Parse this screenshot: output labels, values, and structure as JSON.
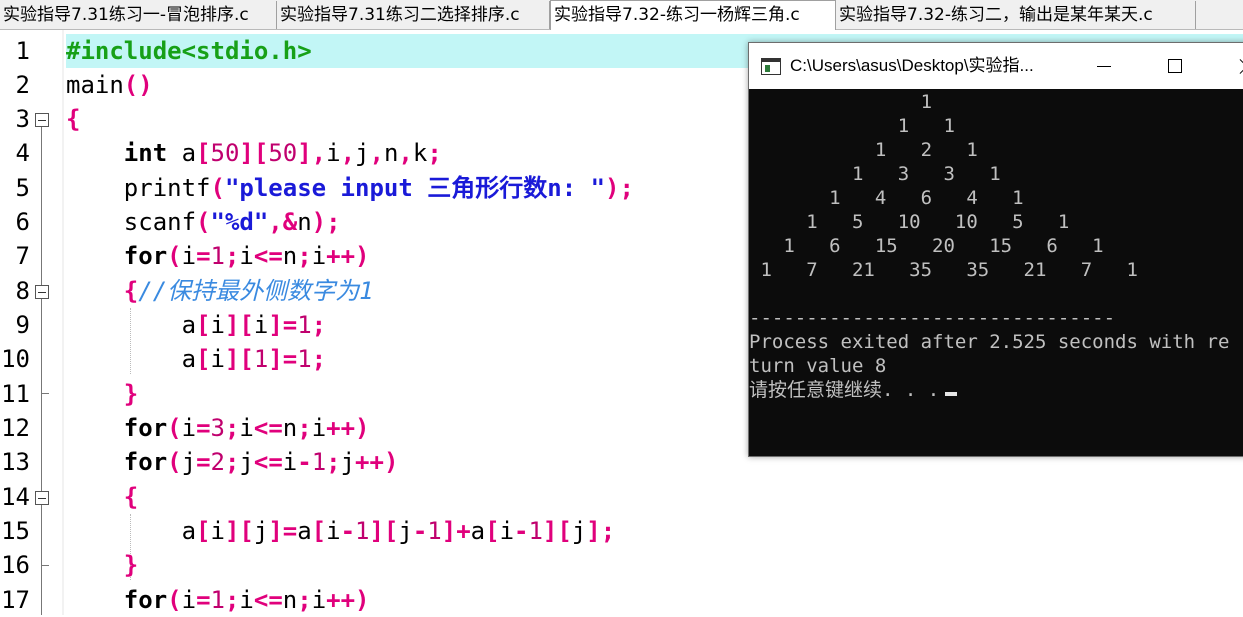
{
  "tabs": [
    {
      "label": "实验指导7.31练习一-冒泡排序.c",
      "active": false
    },
    {
      "label": "实验指导7.31练习二选择排序.c",
      "active": false
    },
    {
      "label": "实验指导7.32-练习一杨辉三角.c",
      "active": true
    },
    {
      "label": "实验指导7.32-练习二，输出是某年某天.c",
      "active": false
    }
  ],
  "editor": {
    "line_numbers": [
      "1",
      "2",
      "3",
      "4",
      "5",
      "6",
      "7",
      "8",
      "9",
      "10",
      "11",
      "12",
      "13",
      "14",
      "15",
      "16",
      "17"
    ],
    "code": {
      "l1": "#include<stdio.h>",
      "l2a": "main",
      "l2b": "()",
      "l3": "{",
      "l4a": "int",
      "l4b": " a",
      "l4c": "[",
      "l4d": "50",
      "l4e": "][",
      "l4f": "50",
      "l4g": "],",
      "l4h": "i",
      "l4i": ",",
      "l4j": "j",
      "l4k": ",",
      "l4l": "n",
      "l4m": ",",
      "l4n": "k",
      "l4o": ";",
      "l5a": "printf",
      "l5b": "(",
      "l5c": "\"please input 三角形行数n: \"",
      "l5d": ");",
      "l6a": "scanf",
      "l6b": "(",
      "l6c": "\"%d\"",
      "l6d": ",&",
      "l6e": "n",
      "l6f": ");",
      "l7a": "for",
      "l7b": "(",
      "l7c": "i",
      "l7d": "=",
      "l7e": "1",
      "l7f": ";",
      "l7g": "i",
      "l7h": "<=",
      "l7i": "n",
      "l7j": ";",
      "l7k": "i",
      "l7l": "++)",
      "l8a": "{",
      "l8b": "//保持最外侧数字为1",
      "l9a": "a",
      "l9b": "[",
      "l9c": "i",
      "l9d": "][",
      "l9e": "i",
      "l9f": "]=",
      "l9g": "1",
      "l9h": ";",
      "l10a": "a",
      "l10b": "[",
      "l10c": "i",
      "l10d": "][",
      "l10e": "1",
      "l10f": "]=",
      "l10g": "1",
      "l10h": ";",
      "l11": "}",
      "l12a": "for",
      "l12b": "(",
      "l12c": "i",
      "l12d": "=",
      "l12e": "3",
      "l12f": ";",
      "l12g": "i",
      "l12h": "<=",
      "l12i": "n",
      "l12j": ";",
      "l12k": "i",
      "l12l": "++)",
      "l13a": "for",
      "l13b": "(",
      "l13c": "j",
      "l13d": "=",
      "l13e": "2",
      "l13f": ";",
      "l13g": "j",
      "l13h": "<=",
      "l13i": "i",
      "l13j": "-",
      "l13k": "1",
      "l13l": ";",
      "l13m": "j",
      "l13n": "++)",
      "l14": "{",
      "l15a": "a",
      "l15b": "[",
      "l15c": "i",
      "l15d": "][",
      "l15e": "j",
      "l15f": "]=",
      "l15g": "a",
      "l15h": "[",
      "l15i": "i",
      "l15j": "-",
      "l15k": "1",
      "l15l": "][",
      "l15m": "j",
      "l15n": "-",
      "l15o": "1",
      "l15p": "]+",
      "l15q": "a",
      "l15r": "[",
      "l15s": "i",
      "l15t": "-",
      "l15u": "1",
      "l15v": "][",
      "l15w": "j",
      "l15x": "];",
      "l16": "}",
      "l17a": "for",
      "l17b": "(",
      "l17c": "i",
      "l17d": "=",
      "l17e": "1",
      "l17f": ";",
      "l17g": "i",
      "l17h": "<=",
      "l17i": "n",
      "l17j": ";",
      "l17k": "i",
      "l17l": "++)"
    }
  },
  "console": {
    "title": "C:\\Users\\asus\\Desktop\\实验指...",
    "lines": [
      "               1",
      "             1   1",
      "           1   2   1",
      "         1   3   3   1",
      "       1   4   6   4   1",
      "     1   5   10   10   5   1",
      "   1   6   15   20   15   6   1",
      " 1   7   21   35   35   21   7   1",
      "",
      "--------------------------------",
      "Process exited after 2.525 seconds with re",
      "turn value 8",
      "请按任意键继续. . ."
    ]
  },
  "colors": {
    "highlight_line": "#c2f6f6",
    "keyword": "#000000",
    "punctuation": "#e0007c",
    "string": "#1a1ad8",
    "number": "#c0006e",
    "preprocessor": "#17a017",
    "comment": "#3a8ae0",
    "console_bg": "#0c0c0c",
    "console_text": "#c0c0c0"
  }
}
